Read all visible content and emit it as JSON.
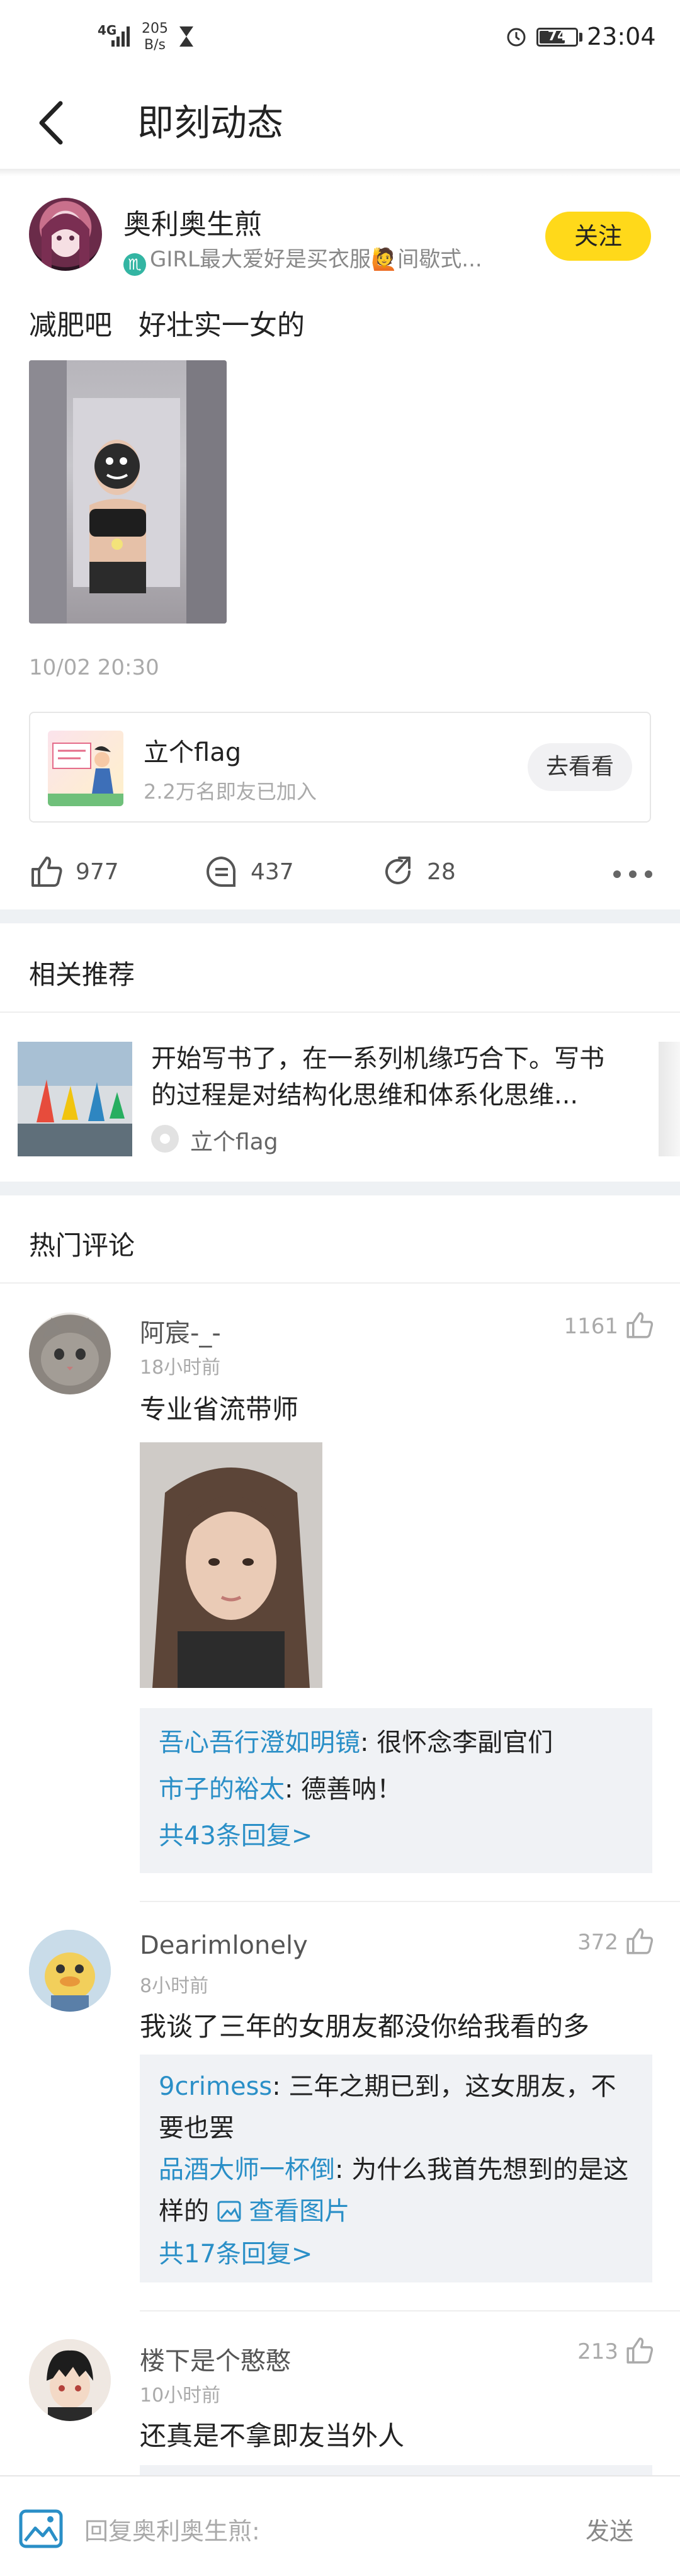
{
  "status_bar": {
    "network": "4G",
    "speed_value": "205",
    "speed_unit": "B/s",
    "battery": "74",
    "battery_level": 0.74,
    "time": "23:04"
  },
  "header": {
    "title": "即刻动态",
    "back_icon": "chevron-left-icon"
  },
  "post": {
    "author_name": "奥利奥生煎",
    "author_signature": "GIRL最大爱好是买衣服🙋间歇式...",
    "signature_badge": "♏",
    "follow_label": "关注",
    "text": "减肥吧   好壮实一女的",
    "date": "10/02 20:30",
    "topic": {
      "title": "立个flag",
      "subtitle": "2.2万名即友已加入",
      "button": "去看看"
    },
    "likes": "977",
    "comments": "437",
    "shares": "28"
  },
  "related": {
    "title": "相关推荐",
    "items": [
      {
        "line1": "开始写书了，在一系列机缘巧合下。写书",
        "line2": "的过程是对结构化思维和体系化思维...",
        "tag": "立个flag"
      }
    ]
  },
  "hot_comments": {
    "title": "热门评论",
    "items": [
      {
        "name": "阿宸-_-",
        "time": "18小时前",
        "text": "专业省流带师",
        "likes": "1161",
        "replies": [
          {
            "who": "吾心吾行澄如明镜",
            "text": ": 很怀念李副官们"
          },
          {
            "who": "市子的裕太",
            "text": ": 德善呐！"
          }
        ],
        "more_replies": "共43条回复>"
      },
      {
        "name": "Dearimlonely",
        "time": "8小时前",
        "text": "我谈了三年的女朋友都没你给我看的多",
        "likes": "372",
        "replies": [
          {
            "who": "9crimess",
            "text": ": 三年之期已到，这女朋友，不要也罢"
          },
          {
            "who": "品酒大师一杯倒",
            "text": ": 为什么我首先想到的是这样的",
            "link": "查看图片"
          }
        ],
        "more_replies": "共17条回复>"
      },
      {
        "name": "楼下是个憨憨",
        "time": "10小时前",
        "text": "还真是不拿即友当外人",
        "likes": "213"
      }
    ]
  },
  "bottom_bar": {
    "placeholder": "回复奥利奥生煎:",
    "send_label": "发送"
  },
  "colors": {
    "accent_yellow": "#ffd91a",
    "link_blue": "#2a8fc7"
  }
}
